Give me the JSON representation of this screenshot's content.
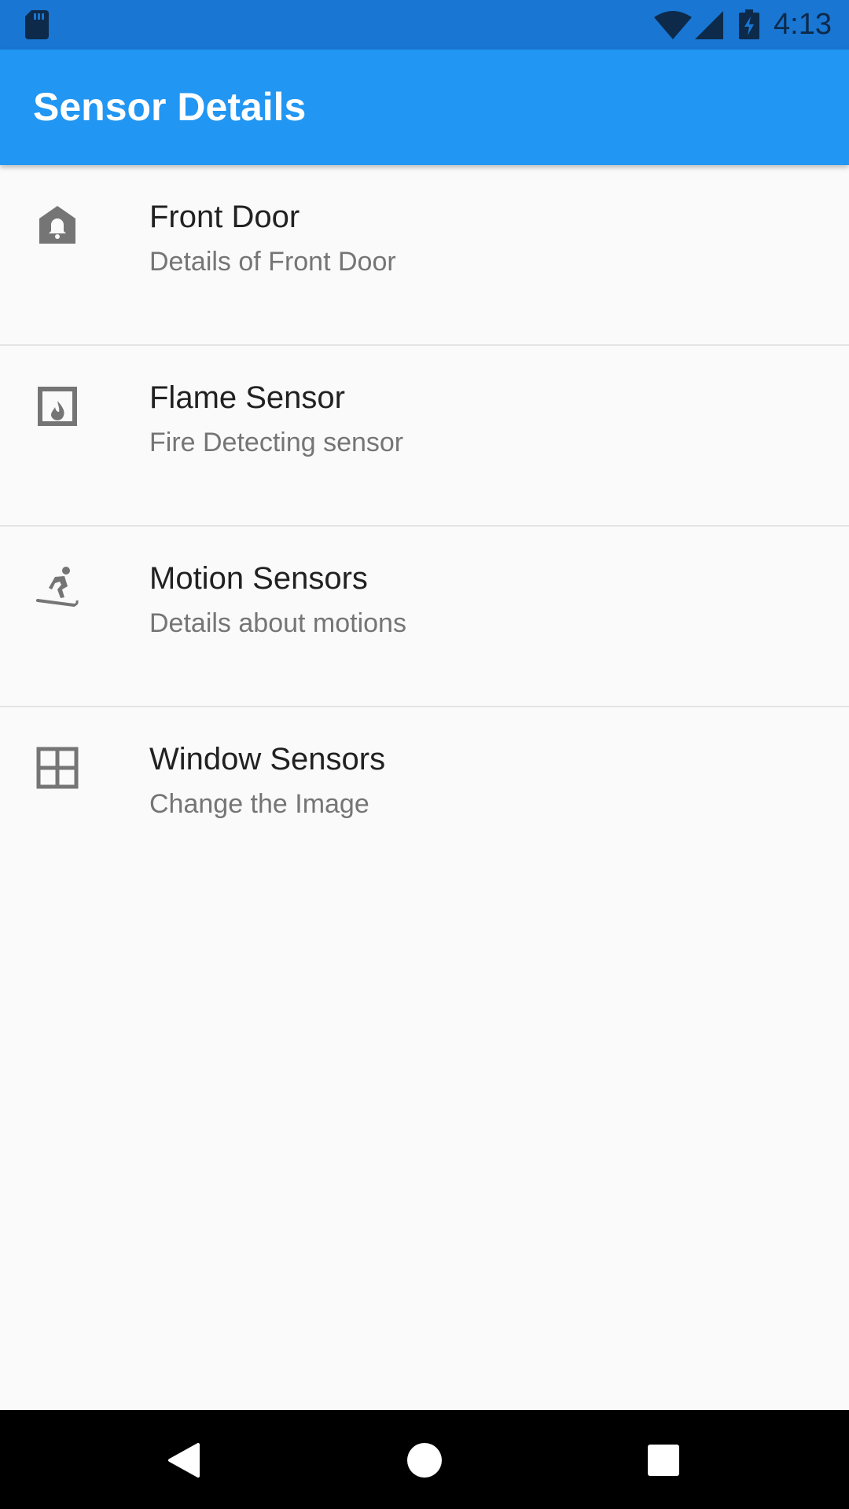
{
  "status_bar": {
    "time": "4:13",
    "icons": [
      "sd-card-icon",
      "wifi-icon",
      "cell-signal-icon",
      "battery-charging-icon"
    ],
    "color": "#1976d2"
  },
  "app_bar": {
    "title": "Sensor Details",
    "color": "#2196f3"
  },
  "sensors": [
    {
      "title": "Front Door",
      "subtitle": "Details of Front Door",
      "icon": "home-alert-icon"
    },
    {
      "title": "Flame Sensor",
      "subtitle": "Fire Detecting sensor",
      "icon": "fireplace-icon"
    },
    {
      "title": "Motion Sensors",
      "subtitle": "Details about motions",
      "icon": "snowboarding-icon"
    },
    {
      "title": "Window Sensors",
      "subtitle": "Change the Image",
      "icon": "window-icon"
    }
  ],
  "nav_bar": {
    "buttons": [
      "back-icon",
      "home-icon",
      "recents-icon"
    ]
  }
}
